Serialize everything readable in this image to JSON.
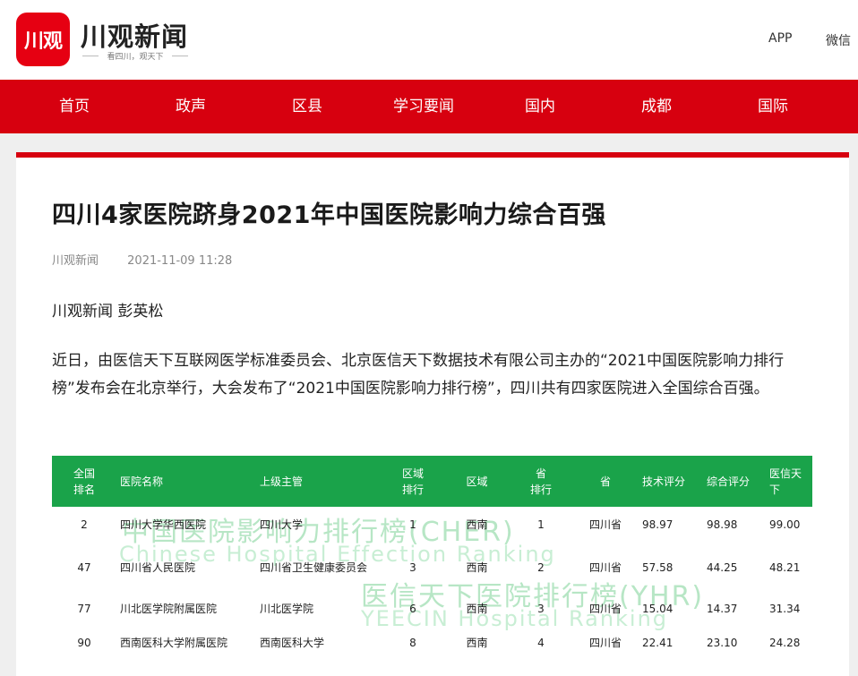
{
  "header": {
    "logo_mark": "川观",
    "logo_title": "川观新闻",
    "logo_slogan": "看四川，观天下",
    "links": [
      "APP",
      "微信"
    ]
  },
  "nav": {
    "items": [
      "首页",
      "政声",
      "区县",
      "学习要闻",
      "国内",
      "成都",
      "国际"
    ]
  },
  "article": {
    "title": "四川4家医院跻身2021年中国医院影响力综合百强",
    "source": "川观新闻",
    "datetime": "2021-11-09 11:28",
    "author": "川观新闻  彭英松",
    "paragraph": "近日，由医信天下互联网医学标准委员会、北京医信天下数据技术有限公司主办的“2021中国医院影响力排行榜”发布会在北京举行，大会发布了“2021中国医院影响力排行榜”，四川共有四家医院进入全国综合百强。"
  },
  "table": {
    "headers": [
      "全国\n排名",
      "医院名称",
      "上级主管",
      "区域\n排行",
      "区域",
      "省\n排行",
      "省",
      "技术评分",
      "综合评分",
      "医信天下"
    ],
    "rows": [
      [
        "2",
        "四川大学华西医院",
        "四川大学",
        "1",
        "西南",
        "1",
        "四川省",
        "98.97",
        "98.98",
        "99.00"
      ],
      [
        "47",
        "四川省人民医院",
        "四川省卫生健康委员会",
        "3",
        "西南",
        "2",
        "四川省",
        "57.58",
        "44.25",
        "48.21"
      ],
      [
        "77",
        "川北医学院附属医院",
        "川北医学院",
        "6",
        "西南",
        "3",
        "四川省",
        "15.04",
        "14.37",
        "31.34"
      ],
      [
        "90",
        "西南医科大学附属医院",
        "西南医科大学",
        "8",
        "西南",
        "4",
        "四川省",
        "22.41",
        "23.10",
        "24.28"
      ]
    ],
    "watermark": {
      "line1": "中国医院影响力排行榜(CHER)",
      "line2": "Chinese Hospital Effection Ranking",
      "line3": "医信天下医院排行榜(YHR)",
      "line4": "YEECIN Hospital Ranking"
    }
  },
  "colors": {
    "brand_red": "#d7000f",
    "table_green": "#1aa34a"
  }
}
